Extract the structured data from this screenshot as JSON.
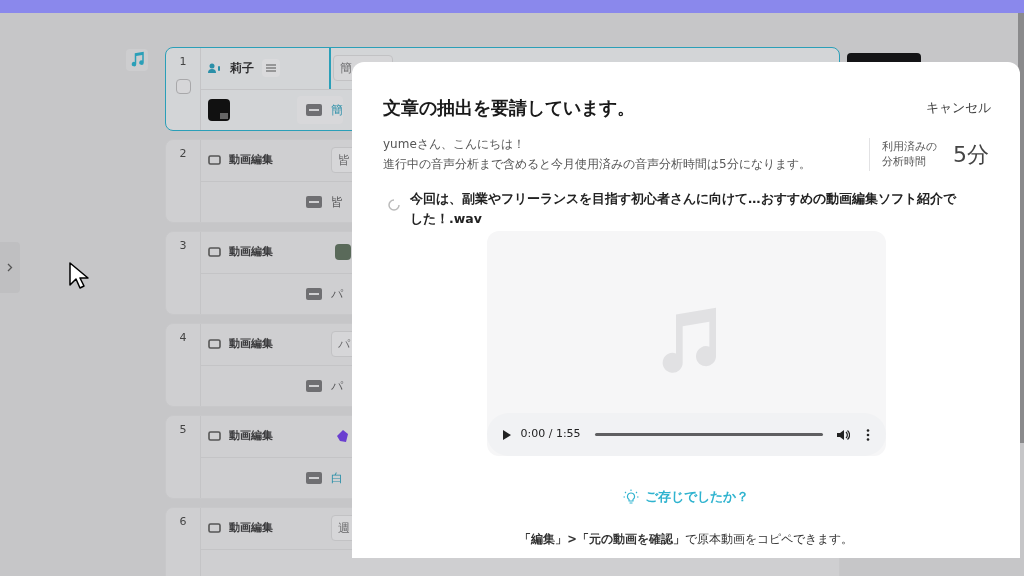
{
  "rows": [
    {
      "number": "1",
      "selected": true,
      "kind": "speaker",
      "label": "莉子",
      "checkbox": {
        "checked": false
      },
      "top": {
        "kind": "text",
        "text": "簡"
      },
      "bottom": {
        "text": "簡",
        "highlighted": true
      }
    },
    {
      "number": "2",
      "selected": false,
      "kind": "video",
      "label": "動画編集",
      "top": {
        "kind": "text",
        "text": "皆"
      },
      "bottom": {
        "text": "皆",
        "highlighted": false
      }
    },
    {
      "number": "3",
      "selected": false,
      "kind": "video",
      "label": "動画編集",
      "top": {
        "kind": "thumbnail"
      },
      "bottom": {
        "text": "パ",
        "highlighted": false
      }
    },
    {
      "number": "4",
      "selected": false,
      "kind": "video",
      "label": "動画編集",
      "top": {
        "kind": "text",
        "text": "パ"
      },
      "bottom": {
        "text": "パ",
        "highlighted": false
      }
    },
    {
      "number": "5",
      "selected": false,
      "kind": "video",
      "label": "動画編集",
      "top": {
        "kind": "sticker"
      },
      "bottom": {
        "text": "白",
        "highlighted": true
      }
    },
    {
      "number": "6",
      "selected": false,
      "kind": "video",
      "label": "動画編集",
      "top": {
        "kind": "text",
        "text": "週"
      }
    }
  ],
  "dialog": {
    "title": "文章の抽出を要請しています。",
    "cancel": "キャンセル",
    "greeting": "yumeさん、こんにちは！",
    "notice": "進行中の音声分析まで含めると今月使用済みの音声分析時間は5分になります。",
    "usage_label": [
      "利用済みの",
      "分析時間"
    ],
    "usage_value": "5分",
    "file_name": "今回は、副業やフリーランスを目指す初心者さんに向けて…おすすめの動画編集ソフト紹介でした！.wav",
    "player": {
      "time": "0:00 / 1:55"
    },
    "tip_title": "ご存じでしたか？",
    "tip_text": "**「編集」>「元の動画を確認」**で原本動画をコピペできます。"
  }
}
